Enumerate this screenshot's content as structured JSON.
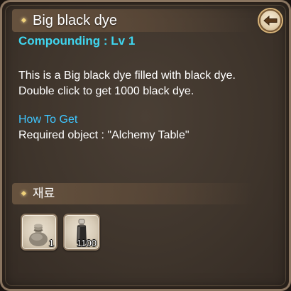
{
  "tooltip": {
    "title": "Big black dye",
    "level": "Compounding : Lv 1",
    "description": [
      "This is a Big black dye filled with black dye.",
      "Double click to get 1000 black dye."
    ],
    "how_to_get_label": "How To Get",
    "how_to_get_text": "Required object : \"Alchemy Table\"",
    "back_icon": "back-arrow-icon"
  },
  "materials": {
    "title": "재료",
    "items": [
      {
        "icon": "pouch-icon",
        "count": "1"
      },
      {
        "icon": "dye-bottle-icon",
        "count": "1100"
      }
    ]
  },
  "colors": {
    "level": "#3fd6f0",
    "how_to_get": "#3fc6ff",
    "panel_bg": "#3f352c",
    "border": "#8a7560",
    "bullet": "#f0d27a"
  }
}
